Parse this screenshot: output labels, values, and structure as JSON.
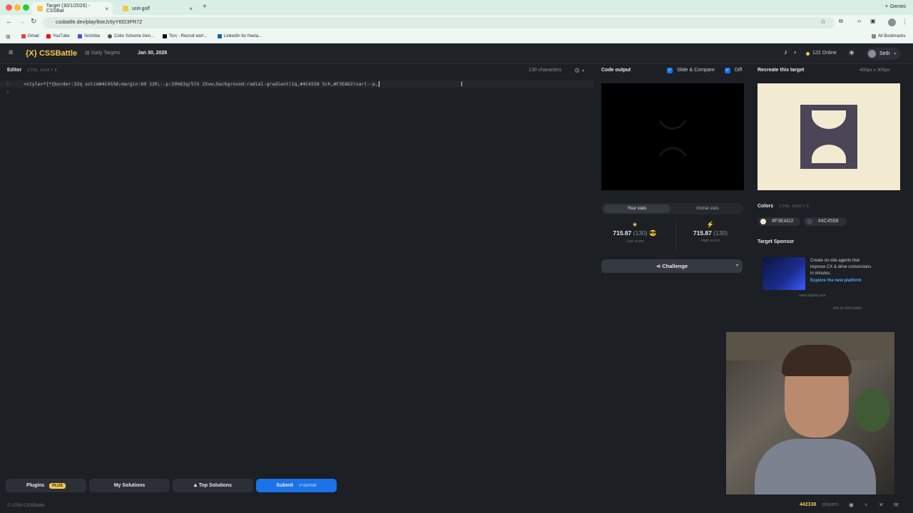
{
  "browser": {
    "tabs": [
      {
        "label": "Target (30/1/2026) - CSSBat",
        "active": true
      },
      {
        "label": "unit-golf",
        "active": false
      }
    ],
    "new_tab": "+",
    "gemini": "Gemini",
    "url": "cssbattle.dev/play/8oeJc6yYt0l23PR7Z",
    "bookmarks": [
      "Gmail",
      "YouTube",
      "Scrimba",
      "Color Scheme Gen...",
      "Torc - Recruit worl...",
      "LinkedIn for freela..."
    ],
    "all_bookmarks": "All Bookmarks"
  },
  "header": {
    "logo": "{X} CSSBattle",
    "daily_targets": "Daily Targets",
    "date": "Jan 30, 2026",
    "online": "122 Online",
    "user": "Seth"
  },
  "editor": {
    "title": "Editor",
    "shortcut": "CTRL SHIFT E",
    "char_count": "130 characters",
    "line1": "<style>*{*{border:32q solid#4C4558;margin:60 120;--p:50%63q/5lh 25vw;background:radial-gradient(1q,#4C4558 5ch,#F3EAD2)var(--p,",
    "line_numbers": [
      "1",
      "2"
    ]
  },
  "footer": {
    "plugins": "Plugins",
    "plus": "PLUS",
    "my_solutions": "My Solutions",
    "top_solutions": "Top Solutions",
    "submit": "Submit",
    "enter": "ENTER",
    "copyright": "© 2026 CSSBattle",
    "players_count": "442338",
    "players_label": "players"
  },
  "output": {
    "title": "Code output",
    "slide_compare": "Slide & Compare",
    "diff": "Diff",
    "stats_tabs": [
      "Your stats",
      "Global stats"
    ],
    "last_score_value": "715.87",
    "last_score_chars": "(130)",
    "last_score_label": "Last score",
    "high_score_value": "715.87",
    "high_score_chars": "(130)",
    "high_score_label": "High score",
    "challenge": "Challenge"
  },
  "target": {
    "title": "Recreate this target",
    "size": "400px x 300px",
    "colors_title": "Colors",
    "colors_shortcut": "CTRL SHIFT C",
    "colors": [
      "#F3EAD2",
      "#4C4558"
    ],
    "sponsor_title": "Target Sponsor",
    "ad_text": "Create on-site agents that improve CX & drive conversions in minutes.",
    "ad_link": "Explore the new platform",
    "ad_domain": "www.algolia.com",
    "ads_by": "Ads by EthicalAds"
  },
  "theme": {
    "accent": "#f2c94c",
    "submit_blue": "#1a73e8",
    "target_bg": "#F3EAD2",
    "target_fg": "#4C4558"
  }
}
